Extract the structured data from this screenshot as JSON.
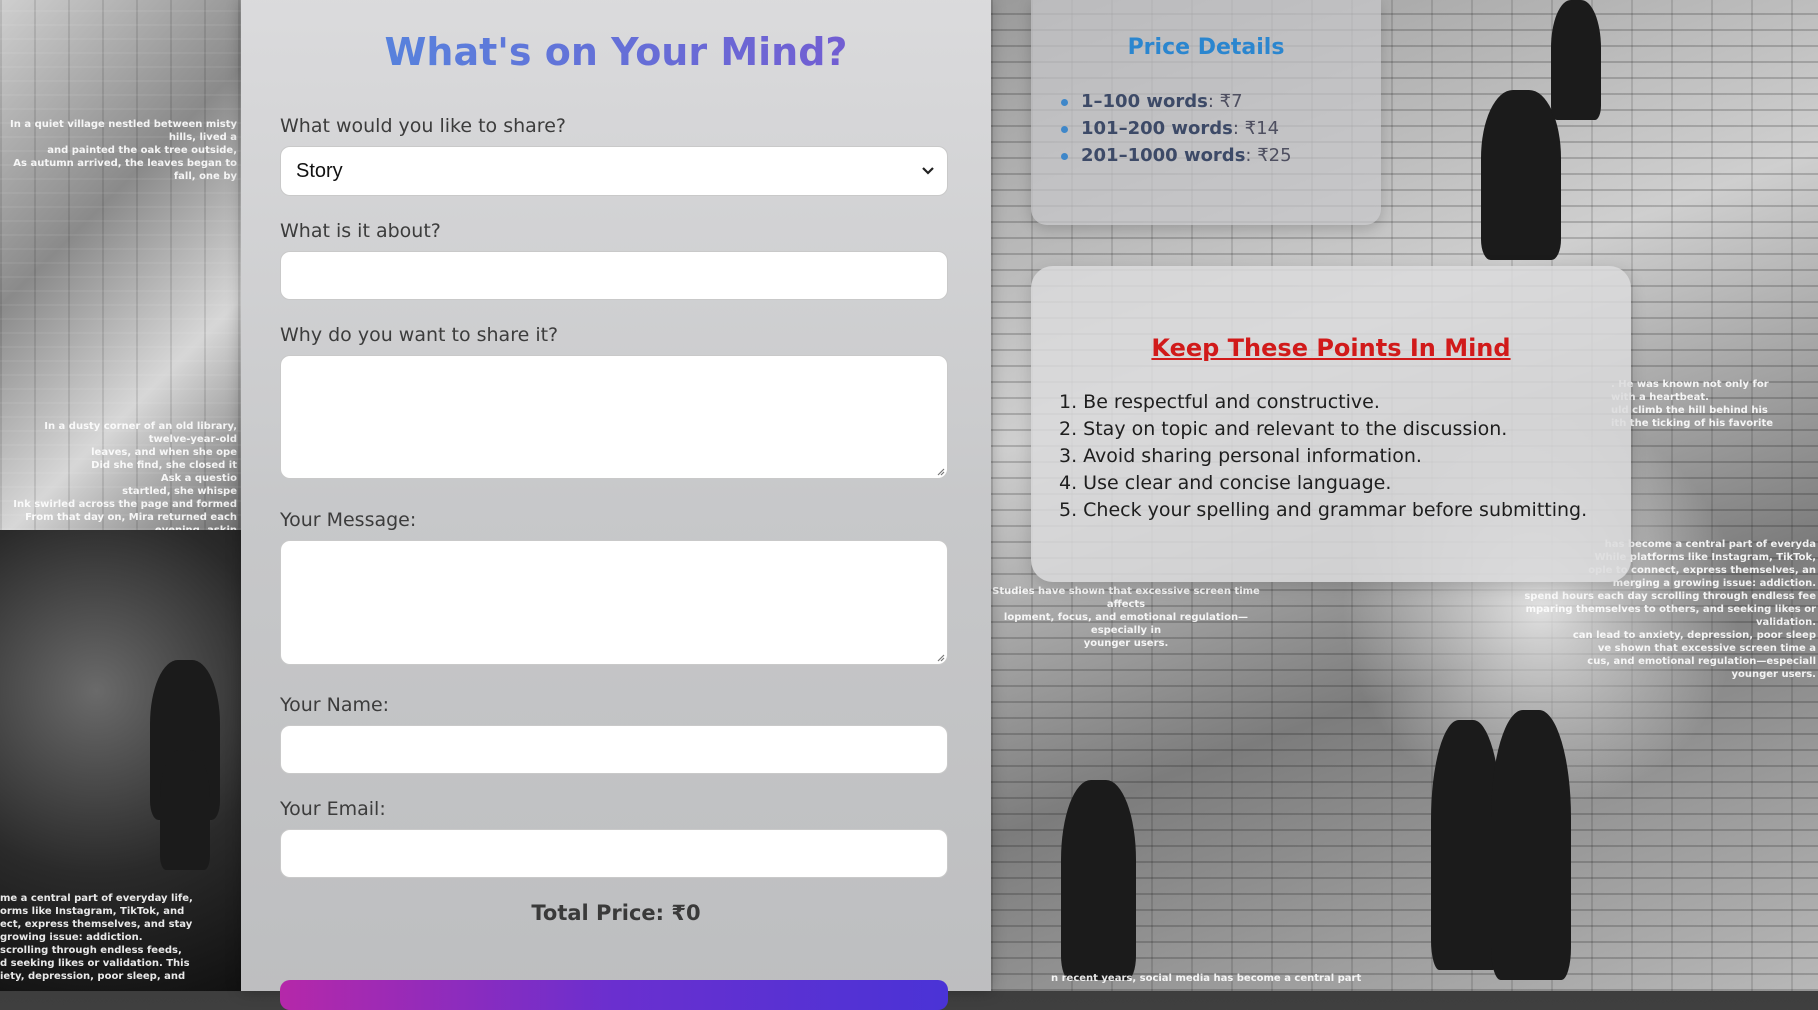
{
  "form": {
    "title": "What's on Your Mind?",
    "share_label": "What would you like to share?",
    "share_selected": "Story",
    "about_label": "What is it about?",
    "about_value": "",
    "why_label": "Why do you want to share it?",
    "why_value": "",
    "message_label": "Your Message:",
    "message_value": "",
    "name_label": "Your Name:",
    "name_value": "",
    "email_label": "Your Email:",
    "email_value": "",
    "total_price": "Total Price: ₹0"
  },
  "price_details": {
    "title": "Price Details",
    "items": [
      {
        "range": "1–100 words",
        "price": ": ₹7"
      },
      {
        "range": "101–200 words",
        "price": ": ₹14"
      },
      {
        "range": "201–1000 words",
        "price": ": ₹25"
      }
    ]
  },
  "rules": {
    "title": "Keep These Points In Mind",
    "items": [
      "1. Be respectful and constructive.",
      "2. Stay on topic and relevant to the discussion.",
      "3. Avoid sharing personal information.",
      "4. Use clear and concise language.",
      "5. Check your spelling and grammar before submitting."
    ]
  },
  "background_text": {
    "left_top": "In a quiet village nestled between misty hills, lived a\nand painted the oak tree outside,\nAs autumn arrived, the leaves began to fall, one by",
    "left_mid": "In a dusty corner of an old library, twelve-year-old\nleaves, and when she ope\nDid she find, she closed it\nAsk a questio\nstartled, she whispe\nInk swirled across the page and formed\nFrom that day on, Mira returned each evening, askin\nmother cried sometimes when she thought no one\nbeaut",
    "left_bottom": "me a central part of everyday life,\norms like Instagram, TikTok, and\nect, express themselves, and stay\ngrowing issue: addiction.\nscrolling through endless feeds,\nd seeking likes or validation. This\niety, depression, poor sleep, and",
    "right_mid": ". He was known not only for\nwith a heartbeat.\nuld climb the hill behind his\nith the ticking of his favorite",
    "right_lower": "has become a central part of everyda\nWhile platforms like Instagram, TikTok,\nople to connect, express themselves, an\nmerging a growing issue: addiction.\nspend hours each day scrolling through endless fee\nmparing themselves to others, and seeking likes or validation.\ncan lead to anxiety, depression, poor sleep\nve shown that excessive screen time a\ncus, and emotional regulation—especiall\nyounger users.",
    "right_middle_left": "Studies have shown that excessive screen time affects\nlopment, focus, and emotional regulation—especially in\nyounger users.",
    "right_bottom": "n recent years, social media has become a central part"
  }
}
